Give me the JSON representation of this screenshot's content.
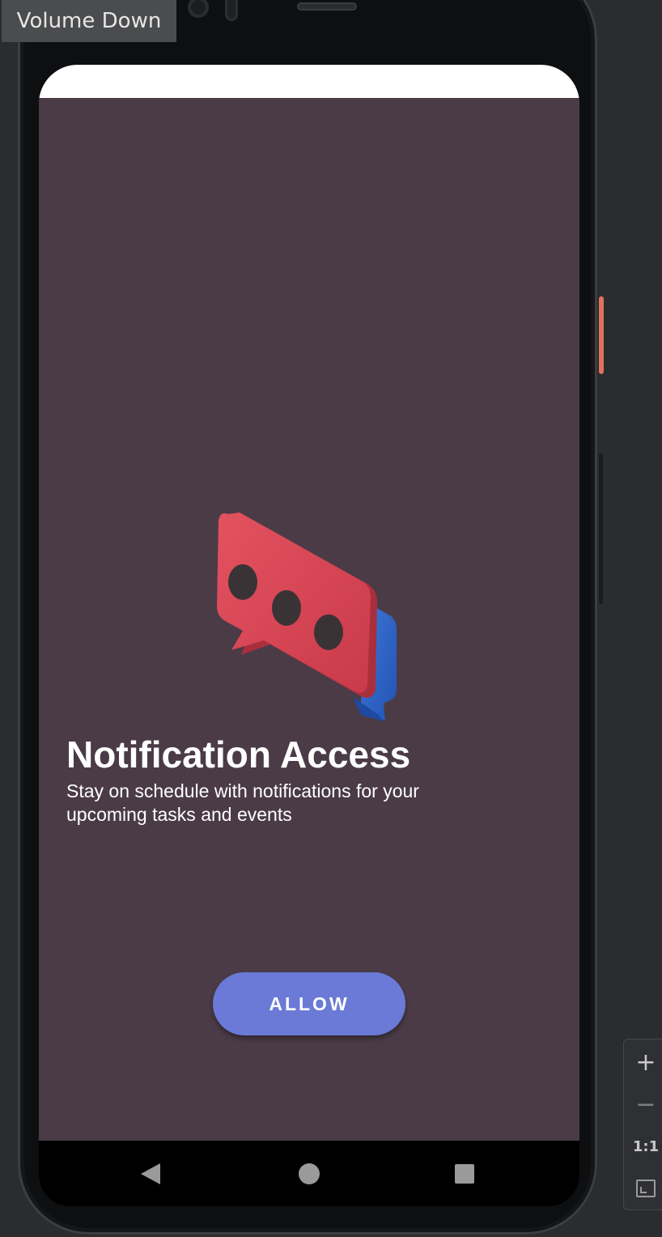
{
  "tooltip": {
    "label": "Volume Down"
  },
  "screen": {
    "background_color": "#4a3b47",
    "illustration": {
      "icon": "chat-bubble-icon"
    },
    "title": "Notification Access",
    "subtitle": "Stay on schedule with notifications for your upcoming tasks and events",
    "allow_button": {
      "label": "ALLOW",
      "color": "#6b7ad6"
    }
  },
  "nav_bar": {
    "back": "back-icon",
    "home": "home-icon",
    "recents": "recents-icon"
  },
  "zoom_controls": {
    "zoom_in": "+",
    "zoom_out": "−",
    "actual_size": "1:1",
    "fit": "fit-screen-icon"
  }
}
